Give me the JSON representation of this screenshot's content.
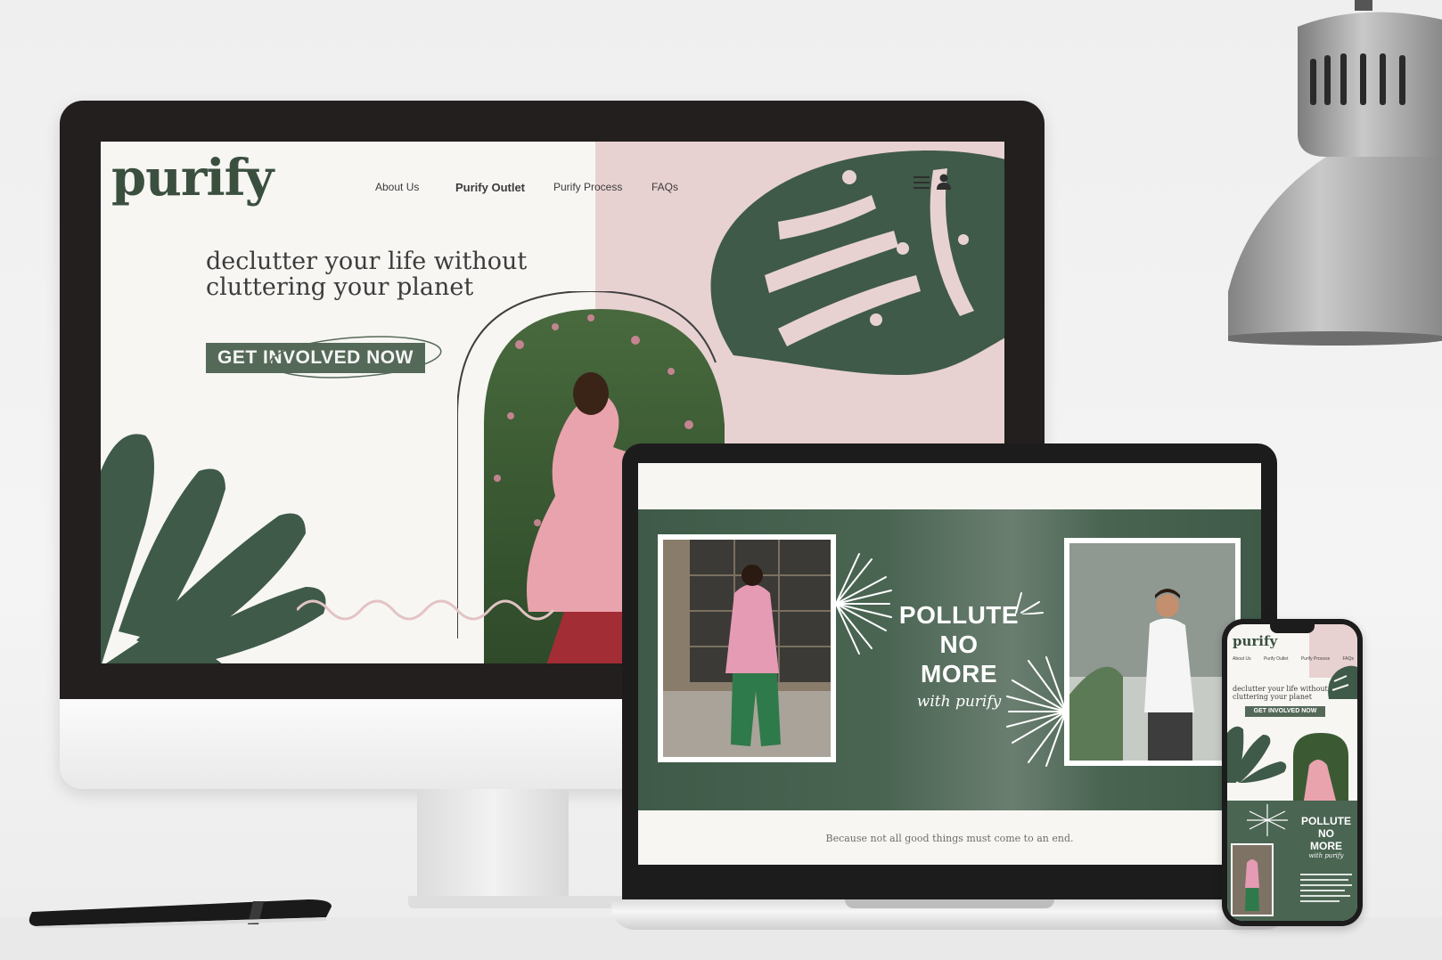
{
  "desktop_site": {
    "logo": "purify",
    "nav": {
      "about": "About Us",
      "outlet": "Purify Outlet",
      "process": "Purify Process",
      "faqs": "FAQs"
    },
    "icons": [
      "menu-icon",
      "user-icon"
    ],
    "headline_line1": "declutter your life without",
    "headline_line2": "cluttering your planet",
    "cta": "GET INVOLVED NOW"
  },
  "laptop_site": {
    "pollute_line1": "POLLUTE",
    "pollute_line2": "NO",
    "pollute_line3": "MORE",
    "with": "with purify",
    "tagline": "Because not all good things must come to an end."
  },
  "mobile_site": {
    "logo": "purify",
    "nav": [
      "About Us",
      "Purify Outlet",
      "Purify Process",
      "FAQs"
    ],
    "headline_line1": "declutter your life without",
    "headline_line2": "cluttering your planet",
    "cta": "GET INVOLVED NOW",
    "pollute_line1": "POLLUTE",
    "pollute_line2": "NO",
    "pollute_line3": "MORE",
    "with": "with purify"
  },
  "colors": {
    "brand_green": "#3b4f3f",
    "band_green": "#4b6553",
    "blush_pink": "#e8d2d1",
    "cream": "#f7f6f3"
  }
}
